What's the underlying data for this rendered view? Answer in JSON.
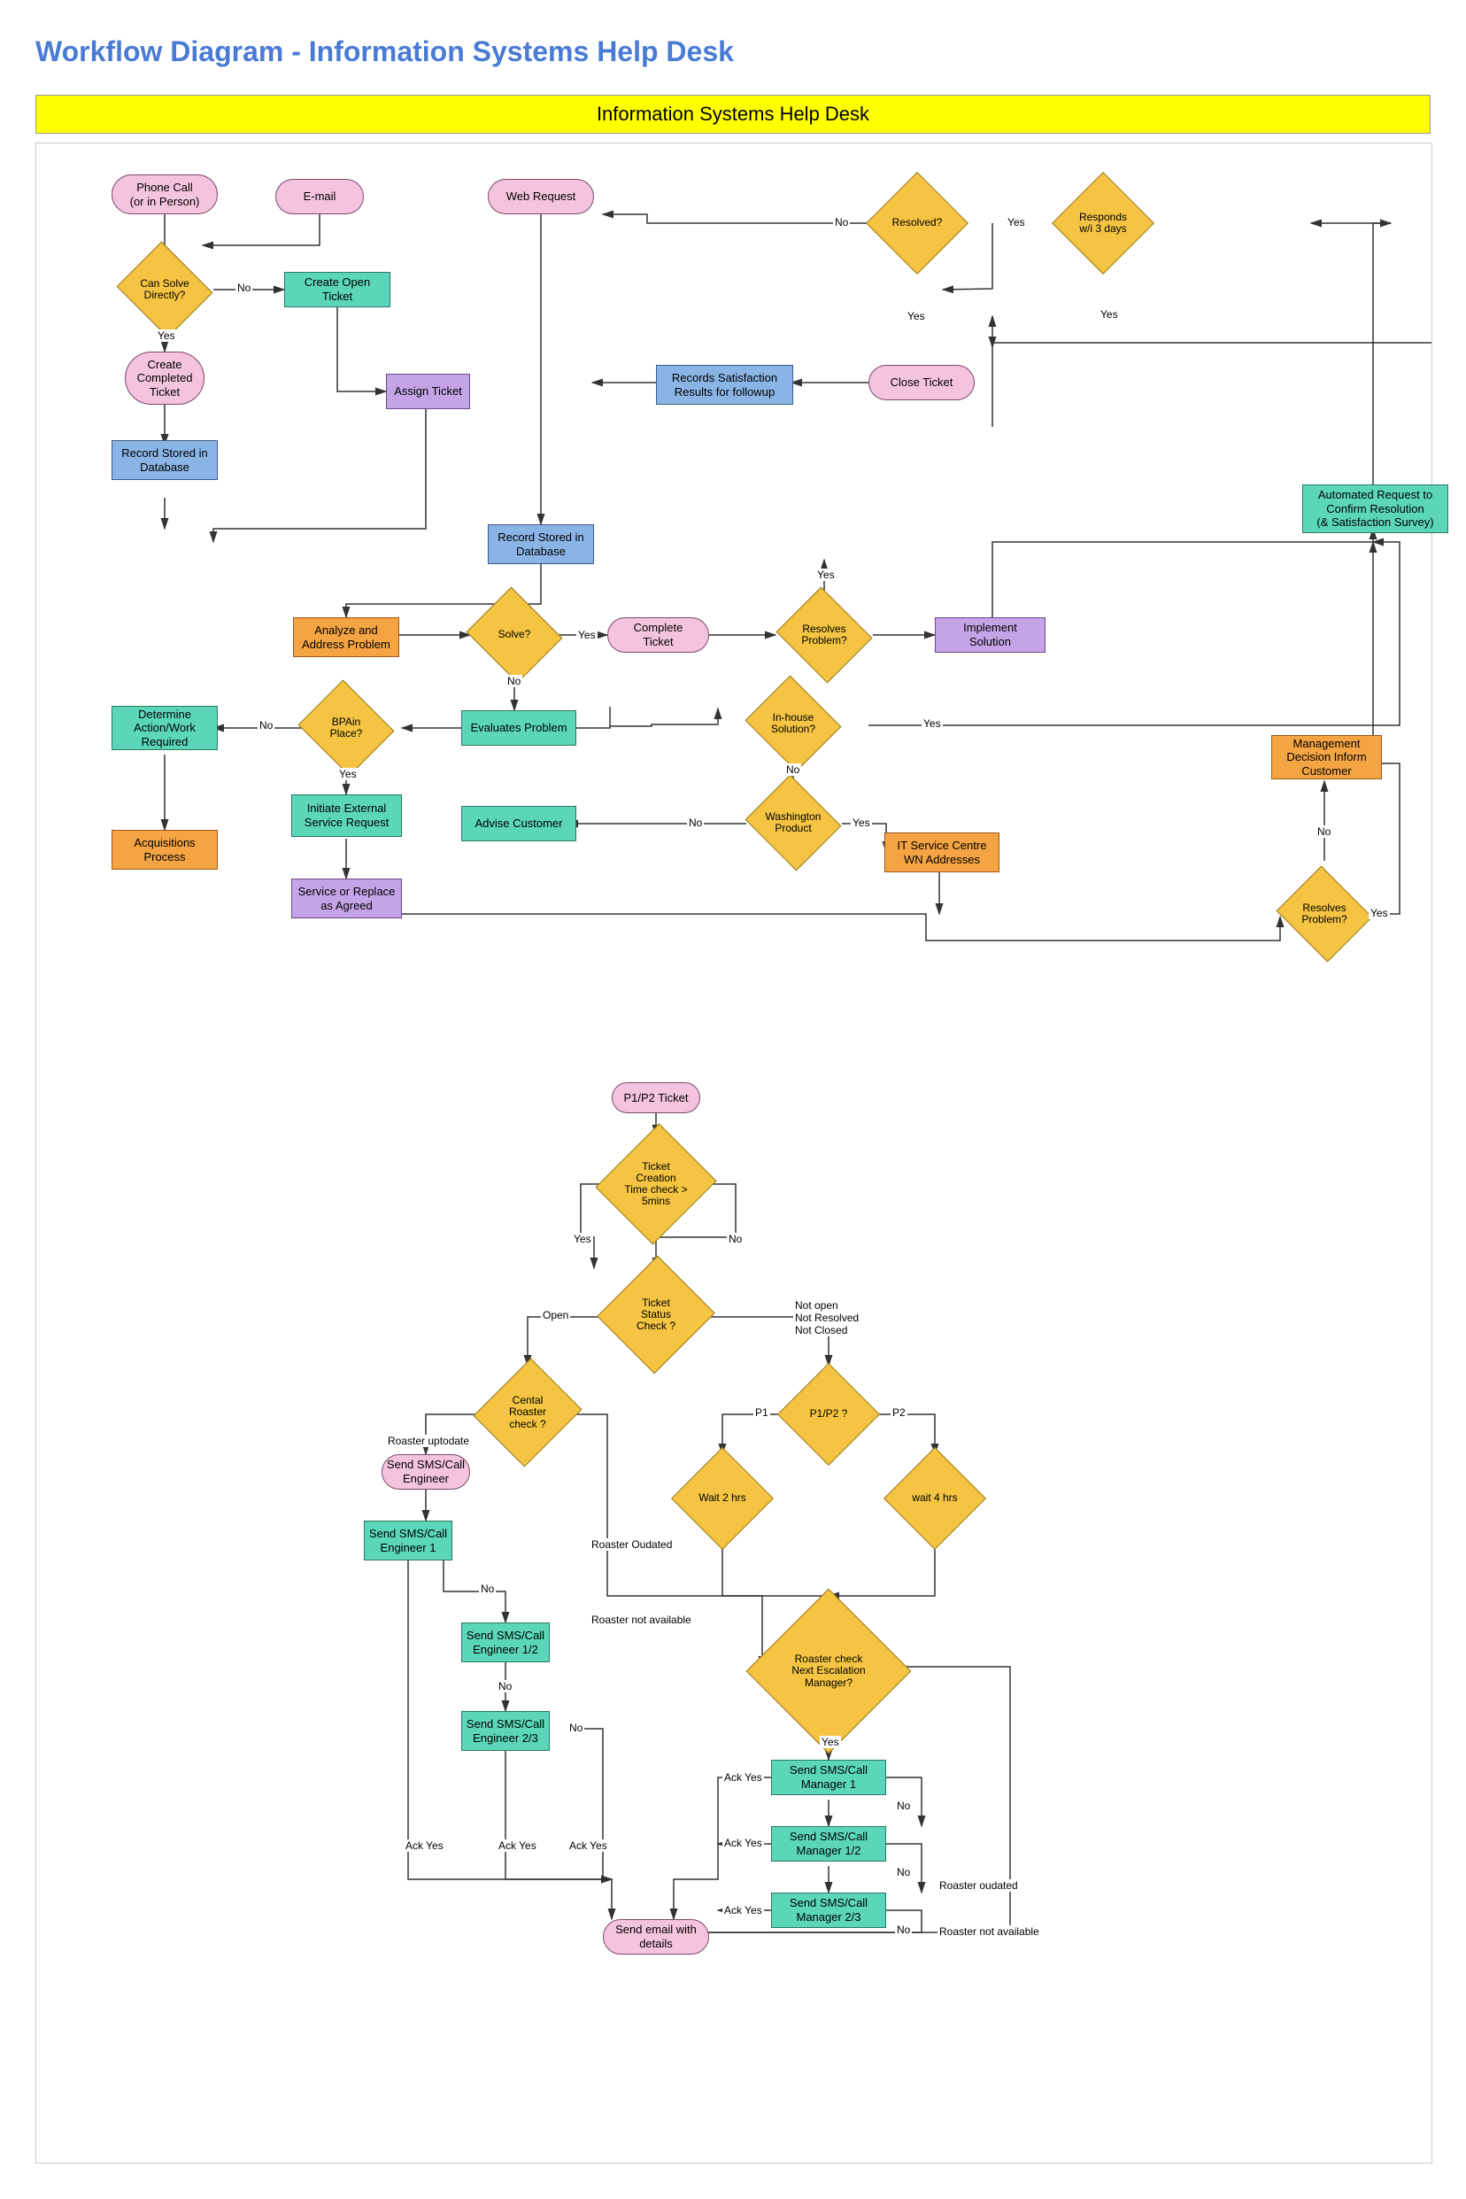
{
  "page_title": "Workflow Diagram - Information Systems Help Desk",
  "banner": "Information Systems Help Desk",
  "nodes": {
    "phone_call": "Phone Call\n(or in Person)",
    "email": "E-mail",
    "web_request": "Web Request",
    "resolved": "Resolved?",
    "responds": "Responds\nw/i 3 days",
    "can_solve": "Can  Solve\nDirectly?",
    "create_open": "Create Open Ticket",
    "assign_ticket": "Assign Ticket",
    "records_sat": "Records Satisfaction\nResults for followup",
    "close_ticket": "Close Ticket",
    "create_completed": "Create\nCompleted\nTicket",
    "record_db1": "Record Stored in\nDatabase",
    "record_db2": "Record Stored in\nDatabase",
    "automated_req": "Automated Request to\nConfirm Resolution\n(& Satisfaction Survey)",
    "analyze": "Analyze and\nAddress Problem",
    "solve": "Solve?",
    "complete_ticket": "Complete\nTicket",
    "resolves1": "Resolves\nProblem?",
    "implement": "Implement\nSolution",
    "determine": "Determine\nAction/Work\nRequired",
    "bpa": "BPAin\nPlace?",
    "evaluates": "Evaluates Problem",
    "inhouse": "In-house\nSolution?",
    "mgmt_decision": "Management\nDecision Inform\nCustomer",
    "initiate_ext": "Initiate External\nService Request",
    "advise": "Advise Customer",
    "washington": "Washington\nProduct",
    "it_service": "IT Service Centre\nWN Addresses",
    "acquisitions": "Acquisitions\nProcess",
    "service_replace": "Service or Replace\nas Agreed",
    "resolves2": "Resolves\nProblem?",
    "p1p2_ticket": "P1/P2 Ticket",
    "ticket_creation": "Ticket\nCreation\nTime check >\n5mins",
    "ticket_status": "Ticket\nStatus\nCheck ?",
    "central_roaster": "Cental\nRoaster\ncheck ?",
    "p1p2_q": "P1/P2 ?",
    "roaster_uptodate": "Roaster uptodate",
    "send_sms_eng": "Send SMS/Call\nEngineer",
    "wait2": "Wait 2 hrs",
    "wait4": "wait 4 hrs",
    "send_eng1": "Send SMS/Call\nEngineer 1",
    "send_eng12": "Send SMS/Call\nEngineer 1/2",
    "send_eng23": "Send SMS/Call\nEngineer 2/3",
    "roaster_outdated": "Roaster Oudated",
    "roaster_na": "Roaster not available",
    "roaster_check_mgr": "Roaster check\nNext Escalation\nManager?",
    "send_mgr1": "Send SMS/Call\nManager 1",
    "send_mgr12": "Send SMS/Call\nManager 1/2",
    "send_mgr23": "Send SMS/Call\nManager 2/3",
    "roaster_outdated2": "Roaster oudated",
    "roaster_na2": "Roaster not available",
    "send_email": "Send email with\ndetails"
  },
  "labels": {
    "yes": "Yes",
    "no": "No",
    "open": "Open",
    "not_open": "Not open\nNot Resolved\nNot Closed",
    "p1": "P1",
    "p2": "P2",
    "ack_yes": "Ack Yes"
  }
}
